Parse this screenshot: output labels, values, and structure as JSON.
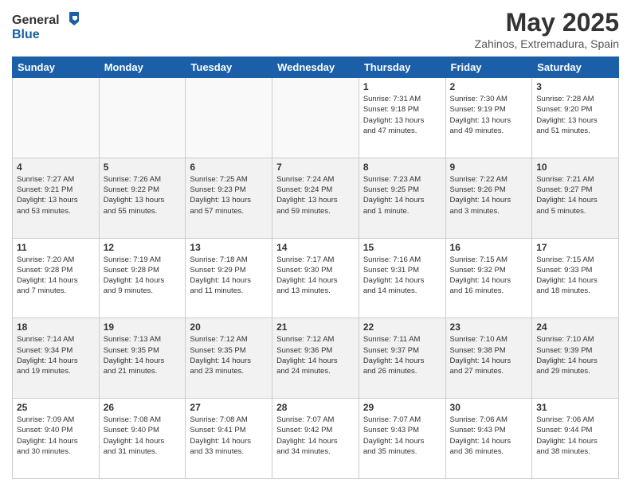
{
  "header": {
    "logo_general": "General",
    "logo_blue": "Blue",
    "month_title": "May 2025",
    "location": "Zahinos, Extremadura, Spain"
  },
  "days_of_week": [
    "Sunday",
    "Monday",
    "Tuesday",
    "Wednesday",
    "Thursday",
    "Friday",
    "Saturday"
  ],
  "weeks": [
    [
      {
        "day": "",
        "info": ""
      },
      {
        "day": "",
        "info": ""
      },
      {
        "day": "",
        "info": ""
      },
      {
        "day": "",
        "info": ""
      },
      {
        "day": "1",
        "info": "Sunrise: 7:31 AM\nSunset: 9:18 PM\nDaylight: 13 hours\nand 47 minutes."
      },
      {
        "day": "2",
        "info": "Sunrise: 7:30 AM\nSunset: 9:19 PM\nDaylight: 13 hours\nand 49 minutes."
      },
      {
        "day": "3",
        "info": "Sunrise: 7:28 AM\nSunset: 9:20 PM\nDaylight: 13 hours\nand 51 minutes."
      }
    ],
    [
      {
        "day": "4",
        "info": "Sunrise: 7:27 AM\nSunset: 9:21 PM\nDaylight: 13 hours\nand 53 minutes."
      },
      {
        "day": "5",
        "info": "Sunrise: 7:26 AM\nSunset: 9:22 PM\nDaylight: 13 hours\nand 55 minutes."
      },
      {
        "day": "6",
        "info": "Sunrise: 7:25 AM\nSunset: 9:23 PM\nDaylight: 13 hours\nand 57 minutes."
      },
      {
        "day": "7",
        "info": "Sunrise: 7:24 AM\nSunset: 9:24 PM\nDaylight: 13 hours\nand 59 minutes."
      },
      {
        "day": "8",
        "info": "Sunrise: 7:23 AM\nSunset: 9:25 PM\nDaylight: 14 hours\nand 1 minute."
      },
      {
        "day": "9",
        "info": "Sunrise: 7:22 AM\nSunset: 9:26 PM\nDaylight: 14 hours\nand 3 minutes."
      },
      {
        "day": "10",
        "info": "Sunrise: 7:21 AM\nSunset: 9:27 PM\nDaylight: 14 hours\nand 5 minutes."
      }
    ],
    [
      {
        "day": "11",
        "info": "Sunrise: 7:20 AM\nSunset: 9:28 PM\nDaylight: 14 hours\nand 7 minutes."
      },
      {
        "day": "12",
        "info": "Sunrise: 7:19 AM\nSunset: 9:28 PM\nDaylight: 14 hours\nand 9 minutes."
      },
      {
        "day": "13",
        "info": "Sunrise: 7:18 AM\nSunset: 9:29 PM\nDaylight: 14 hours\nand 11 minutes."
      },
      {
        "day": "14",
        "info": "Sunrise: 7:17 AM\nSunset: 9:30 PM\nDaylight: 14 hours\nand 13 minutes."
      },
      {
        "day": "15",
        "info": "Sunrise: 7:16 AM\nSunset: 9:31 PM\nDaylight: 14 hours\nand 14 minutes."
      },
      {
        "day": "16",
        "info": "Sunrise: 7:15 AM\nSunset: 9:32 PM\nDaylight: 14 hours\nand 16 minutes."
      },
      {
        "day": "17",
        "info": "Sunrise: 7:15 AM\nSunset: 9:33 PM\nDaylight: 14 hours\nand 18 minutes."
      }
    ],
    [
      {
        "day": "18",
        "info": "Sunrise: 7:14 AM\nSunset: 9:34 PM\nDaylight: 14 hours\nand 19 minutes."
      },
      {
        "day": "19",
        "info": "Sunrise: 7:13 AM\nSunset: 9:35 PM\nDaylight: 14 hours\nand 21 minutes."
      },
      {
        "day": "20",
        "info": "Sunrise: 7:12 AM\nSunset: 9:35 PM\nDaylight: 14 hours\nand 23 minutes."
      },
      {
        "day": "21",
        "info": "Sunrise: 7:12 AM\nSunset: 9:36 PM\nDaylight: 14 hours\nand 24 minutes."
      },
      {
        "day": "22",
        "info": "Sunrise: 7:11 AM\nSunset: 9:37 PM\nDaylight: 14 hours\nand 26 minutes."
      },
      {
        "day": "23",
        "info": "Sunrise: 7:10 AM\nSunset: 9:38 PM\nDaylight: 14 hours\nand 27 minutes."
      },
      {
        "day": "24",
        "info": "Sunrise: 7:10 AM\nSunset: 9:39 PM\nDaylight: 14 hours\nand 29 minutes."
      }
    ],
    [
      {
        "day": "25",
        "info": "Sunrise: 7:09 AM\nSunset: 9:40 PM\nDaylight: 14 hours\nand 30 minutes."
      },
      {
        "day": "26",
        "info": "Sunrise: 7:08 AM\nSunset: 9:40 PM\nDaylight: 14 hours\nand 31 minutes."
      },
      {
        "day": "27",
        "info": "Sunrise: 7:08 AM\nSunset: 9:41 PM\nDaylight: 14 hours\nand 33 minutes."
      },
      {
        "day": "28",
        "info": "Sunrise: 7:07 AM\nSunset: 9:42 PM\nDaylight: 14 hours\nand 34 minutes."
      },
      {
        "day": "29",
        "info": "Sunrise: 7:07 AM\nSunset: 9:43 PM\nDaylight: 14 hours\nand 35 minutes."
      },
      {
        "day": "30",
        "info": "Sunrise: 7:06 AM\nSunset: 9:43 PM\nDaylight: 14 hours\nand 36 minutes."
      },
      {
        "day": "31",
        "info": "Sunrise: 7:06 AM\nSunset: 9:44 PM\nDaylight: 14 hours\nand 38 minutes."
      }
    ]
  ]
}
